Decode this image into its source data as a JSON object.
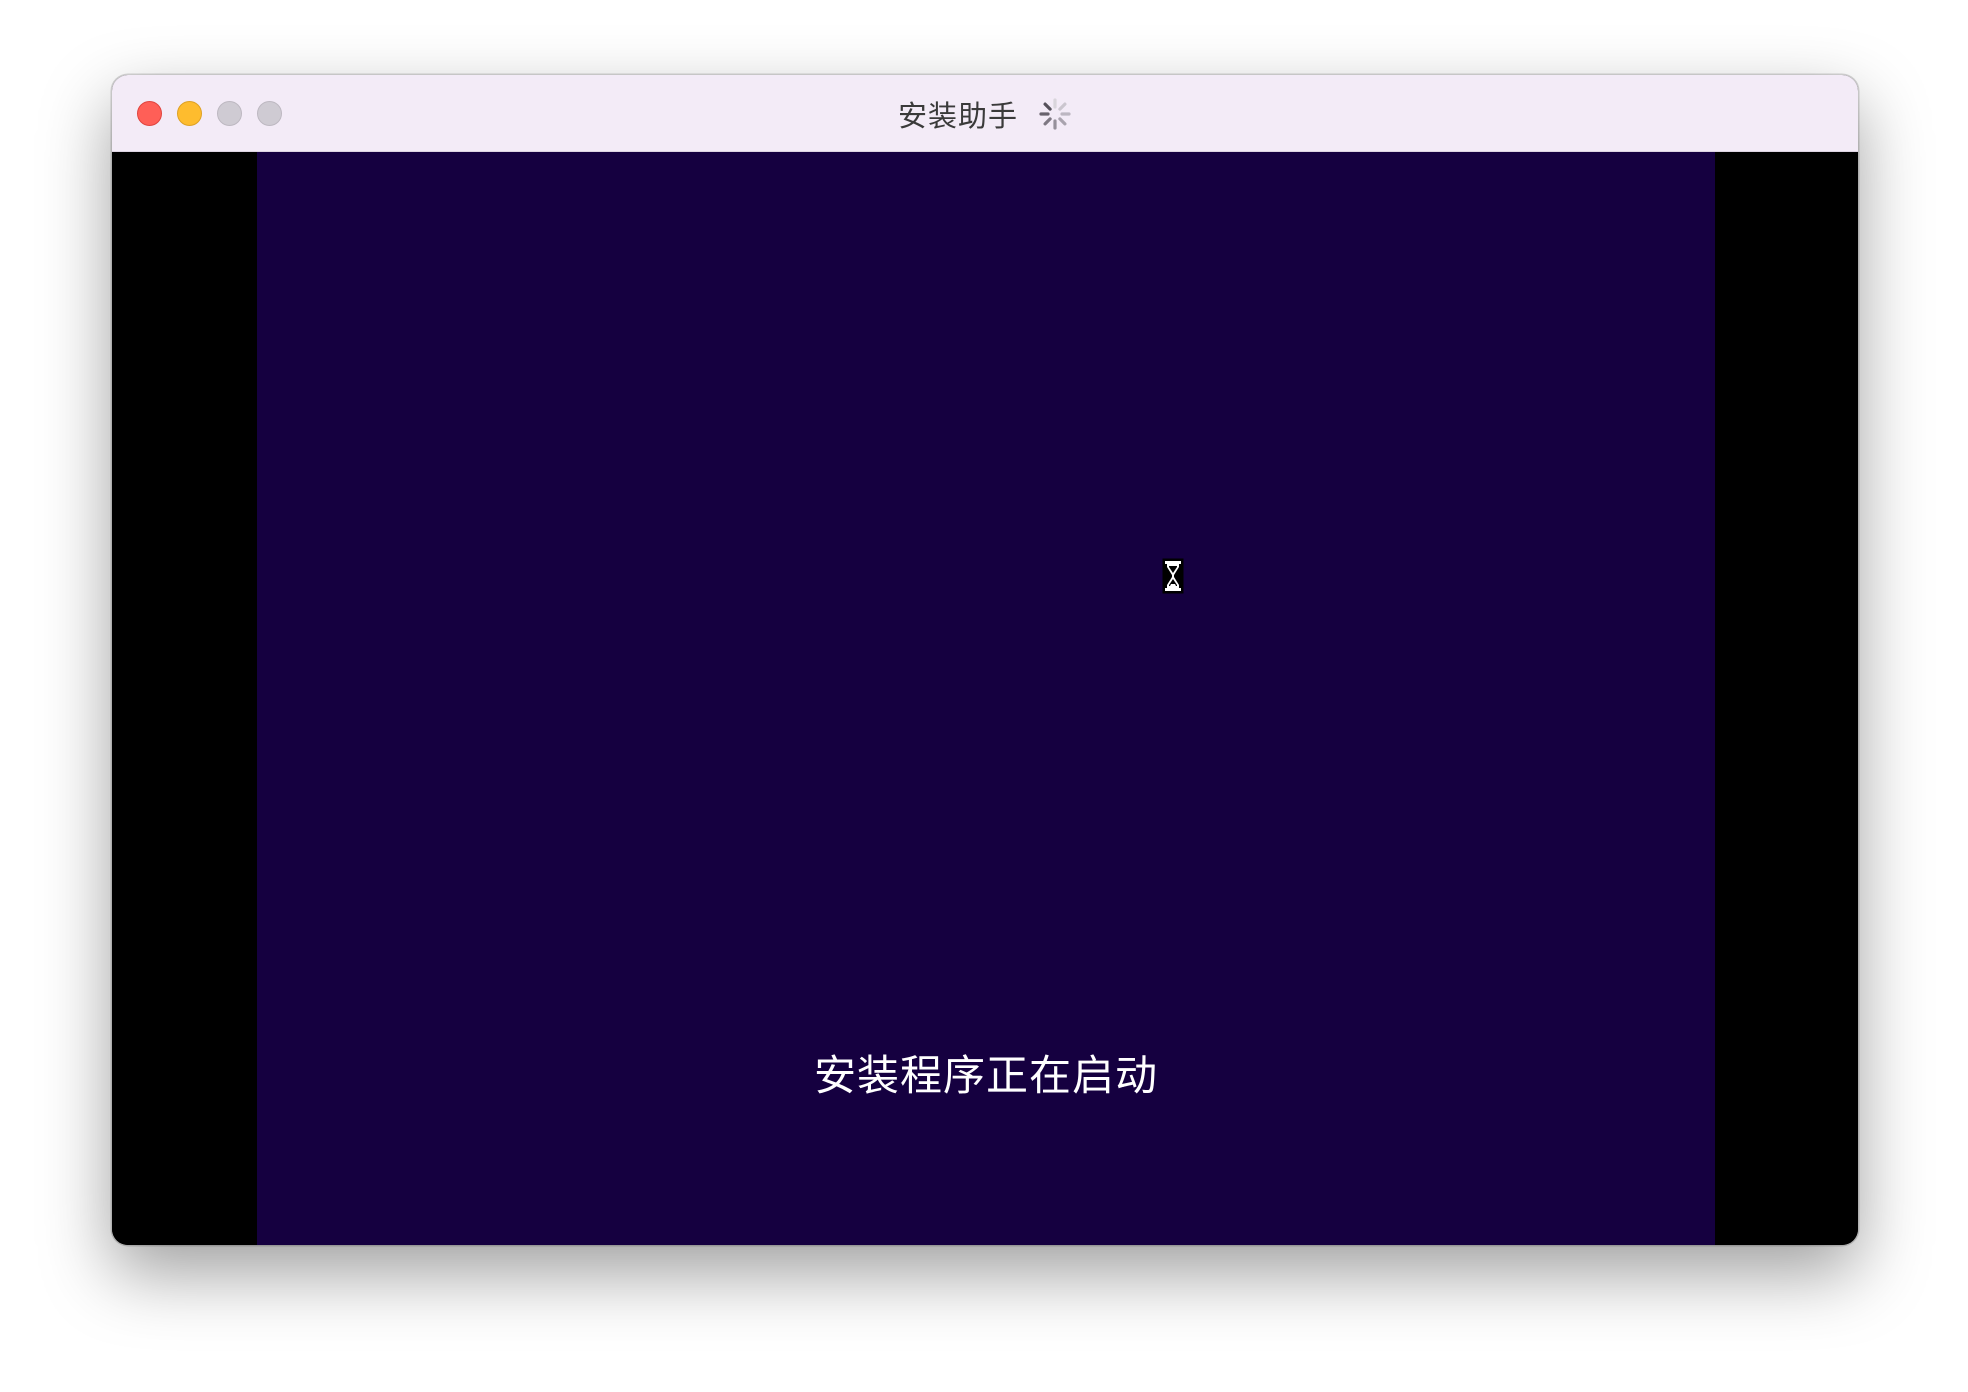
{
  "window": {
    "title": "安装助手",
    "controls": [
      "close",
      "minimize",
      "zoom",
      "extra"
    ]
  },
  "setup_screen": {
    "status": "安装程序正在启动",
    "background_color": "#150040",
    "cursor_icon": "hourglass-icon"
  },
  "icons": {
    "title_spinner": "spinner-icon"
  },
  "colors": {
    "titlebar": "#f3ebf7",
    "close": "#ff5f57",
    "minimize": "#febc2e",
    "inactive": "#cfcbd3",
    "letterbox": "#000000"
  }
}
